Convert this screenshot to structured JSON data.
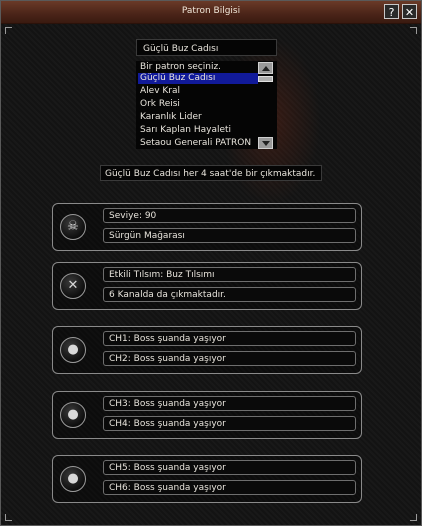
{
  "window": {
    "title": "Patron Bilgisi",
    "help_label": "?",
    "close_label": "✕"
  },
  "selector": {
    "selected_value": "Güçlü Buz Cadısı",
    "items": [
      {
        "label": "Bir patron seçiniz."
      },
      {
        "label": "Güçlü Buz Cadısı",
        "selected": true
      },
      {
        "label": "Alev Kral"
      },
      {
        "label": "Ork Reisi"
      },
      {
        "label": "Karanlık Lider"
      },
      {
        "label": "Sarı Kaplan Hayaleti"
      },
      {
        "label": "Setaou Generali PATRON"
      }
    ]
  },
  "spawn_info": "Güçlü Buz Cadısı her 4 saat'de bir çıkmaktadır.",
  "cards": [
    {
      "icon": "skull-icon",
      "line1": "Seviye: 90",
      "line2": "Sürgün Mağarası"
    },
    {
      "icon": "crossed-bones-icon",
      "line1": "Etkili Tılsım: Buz Tılsımı",
      "line2": "6 Kanalda da çıkmaktadır."
    },
    {
      "icon": "boss-status-icon",
      "line1": "CH1: Boss şuanda yaşıyor",
      "line2": "CH2: Boss şuanda yaşıyor"
    },
    {
      "icon": "boss-status-icon",
      "line1": "CH3: Boss şuanda yaşıyor",
      "line2": "CH4: Boss şuanda yaşıyor"
    },
    {
      "icon": "boss-status-icon",
      "line1": "CH5: Boss şuanda yaşıyor",
      "line2": "CH6: Boss şuanda yaşıyor"
    }
  ],
  "colors": {
    "titlebar": "#5a2c1c",
    "selection": "#111a9a",
    "text": "#e8e4dc"
  }
}
